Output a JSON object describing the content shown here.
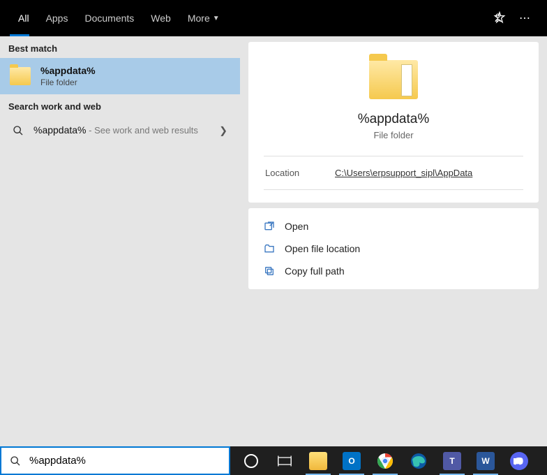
{
  "tabs": {
    "all": "All",
    "apps": "Apps",
    "documents": "Documents",
    "web": "Web",
    "more": "More"
  },
  "sections": {
    "best_match": "Best match",
    "search_work_web": "Search work and web"
  },
  "best_match_result": {
    "title": "%appdata%",
    "subtitle": "File folder"
  },
  "web_result": {
    "term": "%appdata%",
    "hint": " - See work and web results"
  },
  "preview": {
    "title": "%appdata%",
    "subtitle": "File folder",
    "location_label": "Location",
    "location_path": "C:\\Users\\erpsupport_sipl\\AppData"
  },
  "actions": {
    "open": "Open",
    "open_location": "Open file location",
    "copy_path": "Copy full path"
  },
  "search": {
    "value": "%appdata%"
  },
  "colors": {
    "accent": "#0078d4"
  }
}
